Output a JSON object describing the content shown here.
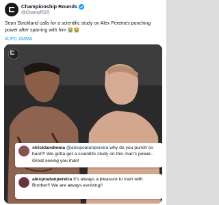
{
  "account": {
    "name": "Championship Rounds",
    "handle": "@ChampRDS"
  },
  "tweet": {
    "text": "Sean Strickland calls for a scientific study on Alex Pereira's punching power after sparring with him 😭😭",
    "hashtags": "#UFC #MMA"
  },
  "comments": [
    {
      "user": "stricklandmma",
      "mention": "@alexpoatanpereira",
      "text": " why do you punch so hard?! We gotta get a scientific study on this man's power.. Great seeing you man!"
    },
    {
      "user": "alexpoatanpereira",
      "mention": "",
      "text": " It's always a pleasure to train with Brother!! We are always evolving!!"
    }
  ],
  "colors": {
    "link": "#1d9bf0",
    "verified": "#1d9bf0",
    "story_ring": "#d6249f"
  }
}
